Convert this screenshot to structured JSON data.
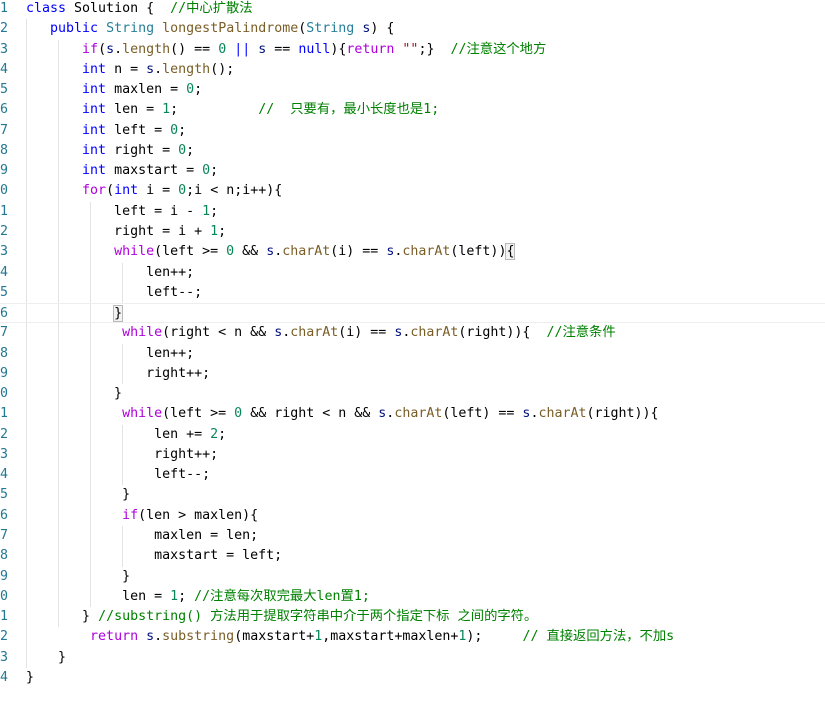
{
  "editor": {
    "language": "java",
    "current_line": 16,
    "colors": {
      "keyword": "#0000ff",
      "control": "#af00db",
      "type": "#267f99",
      "function": "#795e26",
      "number": "#098658",
      "variable": "#001080",
      "comment": "#008000",
      "line_number": "#237893"
    },
    "lines": [
      [
        [
          "kw",
          "class"
        ],
        [
          "t",
          " Solution {  "
        ],
        [
          "cmt",
          "//中心扩散法"
        ]
      ],
      [
        [
          "t",
          "   "
        ],
        [
          "kw",
          "public"
        ],
        [
          "t",
          " "
        ],
        [
          "type",
          "String"
        ],
        [
          "t",
          " "
        ],
        [
          "fn",
          "longestPalindrome"
        ],
        [
          "t",
          "("
        ],
        [
          "type",
          "String"
        ],
        [
          "t",
          " "
        ],
        [
          "var",
          "s"
        ],
        [
          "t",
          ") {"
        ]
      ],
      [
        [
          "t",
          "       "
        ],
        [
          "ctl",
          "if"
        ],
        [
          "t",
          "("
        ],
        [
          "var",
          "s"
        ],
        [
          "t",
          "."
        ],
        [
          "fn",
          "length"
        ],
        [
          "t",
          "() == "
        ],
        [
          "num",
          "0"
        ],
        [
          "t",
          " "
        ],
        [
          "kw",
          "||"
        ],
        [
          "t",
          " "
        ],
        [
          "var",
          "s"
        ],
        [
          "t",
          " == "
        ],
        [
          "kw",
          "null"
        ],
        [
          "t",
          "){"
        ],
        [
          "ctl",
          "return"
        ],
        [
          "t",
          " "
        ],
        [
          "str",
          "\"\""
        ],
        [
          "t",
          ";}  "
        ],
        [
          "cmt",
          "//注意这个地方"
        ]
      ],
      [
        [
          "t",
          "       "
        ],
        [
          "kw",
          "int"
        ],
        [
          "t",
          " n = "
        ],
        [
          "var",
          "s"
        ],
        [
          "t",
          "."
        ],
        [
          "fn",
          "length"
        ],
        [
          "t",
          "();"
        ]
      ],
      [
        [
          "t",
          "       "
        ],
        [
          "kw",
          "int"
        ],
        [
          "t",
          " maxlen = "
        ],
        [
          "num",
          "0"
        ],
        [
          "t",
          ";"
        ]
      ],
      [
        [
          "t",
          "       "
        ],
        [
          "kw",
          "int"
        ],
        [
          "t",
          " len = "
        ],
        [
          "num",
          "1"
        ],
        [
          "t",
          ";          "
        ],
        [
          "cmt",
          "//  只要有，最小长度也是1;"
        ]
      ],
      [
        [
          "t",
          "       "
        ],
        [
          "kw",
          "int"
        ],
        [
          "t",
          " left = "
        ],
        [
          "num",
          "0"
        ],
        [
          "t",
          ";"
        ]
      ],
      [
        [
          "t",
          "       "
        ],
        [
          "kw",
          "int"
        ],
        [
          "t",
          " right = "
        ],
        [
          "num",
          "0"
        ],
        [
          "t",
          ";"
        ]
      ],
      [
        [
          "t",
          "       "
        ],
        [
          "kw",
          "int"
        ],
        [
          "t",
          " maxstart = "
        ],
        [
          "num",
          "0"
        ],
        [
          "t",
          ";"
        ]
      ],
      [
        [
          "t",
          "       "
        ],
        [
          "ctl",
          "for"
        ],
        [
          "t",
          "("
        ],
        [
          "kw",
          "int"
        ],
        [
          "t",
          " i = "
        ],
        [
          "num",
          "0"
        ],
        [
          "t",
          ";i < n;i++){"
        ]
      ],
      [
        [
          "t",
          "           left = i - "
        ],
        [
          "num",
          "1"
        ],
        [
          "t",
          ";"
        ]
      ],
      [
        [
          "t",
          "           right = i + "
        ],
        [
          "num",
          "1"
        ],
        [
          "t",
          ";"
        ]
      ],
      [
        [
          "t",
          "           "
        ],
        [
          "ctl",
          "while"
        ],
        [
          "t",
          "(left >= "
        ],
        [
          "num",
          "0"
        ],
        [
          "t",
          " && "
        ],
        [
          "var",
          "s"
        ],
        [
          "t",
          "."
        ],
        [
          "fn",
          "charAt"
        ],
        [
          "t",
          "(i) == "
        ],
        [
          "var",
          "s"
        ],
        [
          "t",
          "."
        ],
        [
          "fn",
          "charAt"
        ],
        [
          "t",
          "(left))"
        ],
        [
          "br",
          "{"
        ]
      ],
      [
        [
          "t",
          "               len++;"
        ]
      ],
      [
        [
          "t",
          "               left--;"
        ]
      ],
      [
        [
          "t",
          "           "
        ],
        [
          "br",
          "}"
        ]
      ],
      [
        [
          "t",
          "            "
        ],
        [
          "ctl",
          "while"
        ],
        [
          "t",
          "(right < n && "
        ],
        [
          "var",
          "s"
        ],
        [
          "t",
          "."
        ],
        [
          "fn",
          "charAt"
        ],
        [
          "t",
          "(i) == "
        ],
        [
          "var",
          "s"
        ],
        [
          "t",
          "."
        ],
        [
          "fn",
          "charAt"
        ],
        [
          "t",
          "(right)){  "
        ],
        [
          "cmt",
          "//注意条件"
        ]
      ],
      [
        [
          "t",
          "               len++;"
        ]
      ],
      [
        [
          "t",
          "               right++;"
        ]
      ],
      [
        [
          "t",
          "           }"
        ]
      ],
      [
        [
          "t",
          "            "
        ],
        [
          "ctl",
          "while"
        ],
        [
          "t",
          "(left >= "
        ],
        [
          "num",
          "0"
        ],
        [
          "t",
          " && right < n && "
        ],
        [
          "var",
          "s"
        ],
        [
          "t",
          "."
        ],
        [
          "fn",
          "charAt"
        ],
        [
          "t",
          "(left) == "
        ],
        [
          "var",
          "s"
        ],
        [
          "t",
          "."
        ],
        [
          "fn",
          "charAt"
        ],
        [
          "t",
          "(right)){"
        ]
      ],
      [
        [
          "t",
          "                len += "
        ],
        [
          "num",
          "2"
        ],
        [
          "t",
          ";"
        ]
      ],
      [
        [
          "t",
          "                right++;"
        ]
      ],
      [
        [
          "t",
          "                left--;"
        ]
      ],
      [
        [
          "t",
          "            }"
        ]
      ],
      [
        [
          "t",
          "            "
        ],
        [
          "ctl",
          "if"
        ],
        [
          "t",
          "(len > maxlen){"
        ]
      ],
      [
        [
          "t",
          "                maxlen = len;"
        ]
      ],
      [
        [
          "t",
          "                maxstart = left;"
        ]
      ],
      [
        [
          "t",
          "            }"
        ]
      ],
      [
        [
          "t",
          "            len = "
        ],
        [
          "num",
          "1"
        ],
        [
          "t",
          "; "
        ],
        [
          "cmt",
          "//注意每次取完最大len置1;"
        ]
      ],
      [
        [
          "t",
          "       } "
        ],
        [
          "cmt",
          "//substring() 方法用于提取字符串中介于两个指定下标 之间的字符。"
        ]
      ],
      [
        [
          "t",
          "        "
        ],
        [
          "ctl",
          "return"
        ],
        [
          "t",
          " "
        ],
        [
          "var",
          "s"
        ],
        [
          "t",
          "."
        ],
        [
          "fn",
          "substring"
        ],
        [
          "t",
          "(maxstart+"
        ],
        [
          "num",
          "1"
        ],
        [
          "t",
          ",maxstart+maxlen+"
        ],
        [
          "num",
          "1"
        ],
        [
          "t",
          ");     "
        ],
        [
          "cmt",
          "// 直接返回方法，不加s"
        ]
      ],
      [
        [
          "t",
          "    }"
        ]
      ],
      [
        [
          "t",
          "}"
        ]
      ]
    ]
  }
}
